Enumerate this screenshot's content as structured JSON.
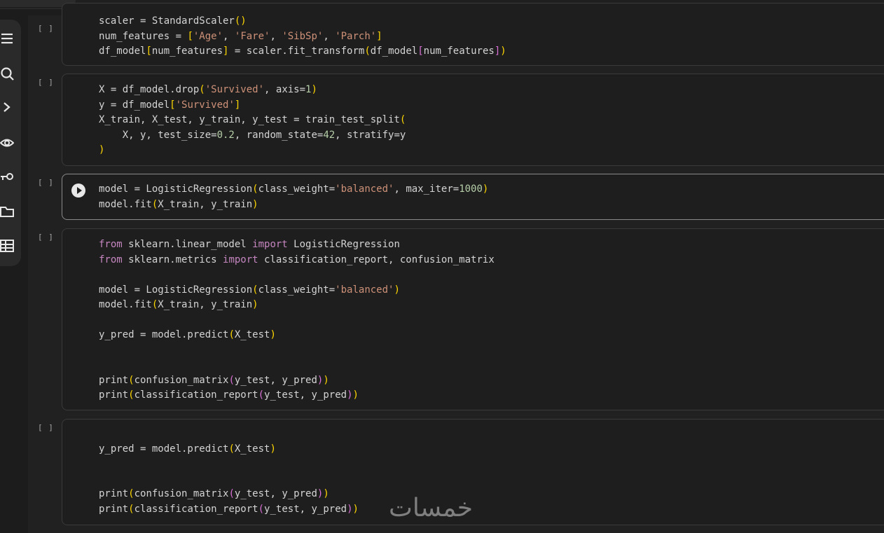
{
  "cells": [
    {
      "exec": "[ ]",
      "lines": [
        [
          {
            "t": "scaler = StandardScaler"
          },
          {
            "t": "()",
            "c": "p1"
          }
        ],
        [
          {
            "t": "num_features = "
          },
          {
            "t": "[",
            "c": "p1"
          },
          {
            "t": "'Age'",
            "c": "st"
          },
          {
            "t": ", "
          },
          {
            "t": "'Fare'",
            "c": "st"
          },
          {
            "t": ", "
          },
          {
            "t": "'SibSp'",
            "c": "st"
          },
          {
            "t": ", "
          },
          {
            "t": "'Parch'",
            "c": "st"
          },
          {
            "t": "]",
            "c": "p1"
          }
        ],
        [
          {
            "t": "df_model"
          },
          {
            "t": "[",
            "c": "p1"
          },
          {
            "t": "num_features"
          },
          {
            "t": "]",
            "c": "p1"
          },
          {
            "t": " = scaler.fit_transform"
          },
          {
            "t": "(",
            "c": "p1"
          },
          {
            "t": "df_model"
          },
          {
            "t": "[",
            "c": "p2"
          },
          {
            "t": "num_features"
          },
          {
            "t": "]",
            "c": "p2"
          },
          {
            "t": ")",
            "c": "p1"
          }
        ]
      ]
    },
    {
      "exec": "[ ]",
      "lines": [
        [
          {
            "t": "X = df_model.drop"
          },
          {
            "t": "(",
            "c": "p1"
          },
          {
            "t": "'Survived'",
            "c": "st"
          },
          {
            "t": ", axis="
          },
          {
            "t": "1",
            "c": "nu"
          },
          {
            "t": ")",
            "c": "p1"
          }
        ],
        [
          {
            "t": "y = df_model"
          },
          {
            "t": "[",
            "c": "p1"
          },
          {
            "t": "'Survived'",
            "c": "st"
          },
          {
            "t": "]",
            "c": "p1"
          }
        ],
        [
          {
            "t": "X_train, X_test, y_train, y_test = train_test_split"
          },
          {
            "t": "(",
            "c": "p1"
          }
        ],
        [
          {
            "t": "    X, y, test_size="
          },
          {
            "t": "0.2",
            "c": "nu"
          },
          {
            "t": ", random_state="
          },
          {
            "t": "42",
            "c": "nu"
          },
          {
            "t": ", stratify=y"
          }
        ],
        [
          {
            "t": ")",
            "c": "p1"
          }
        ]
      ]
    },
    {
      "exec": "[ ]",
      "run_button": "play-icon",
      "lines": [
        [
          {
            "t": "model = LogisticRegression"
          },
          {
            "t": "(",
            "c": "p1"
          },
          {
            "t": "class_weight="
          },
          {
            "t": "'balanced'",
            "c": "st"
          },
          {
            "t": ", max_iter="
          },
          {
            "t": "1000",
            "c": "nu"
          },
          {
            "t": ")",
            "c": "p1"
          }
        ],
        [
          {
            "t": "model.fit"
          },
          {
            "t": "(",
            "c": "p1"
          },
          {
            "t": "X_train, y_train"
          },
          {
            "t": ")",
            "c": "p1"
          }
        ]
      ]
    },
    {
      "exec": "[ ]",
      "lines": [
        [
          {
            "t": "from",
            "c": "kw"
          },
          {
            "t": " sklearn.linear_model "
          },
          {
            "t": "import",
            "c": "kw"
          },
          {
            "t": " LogisticRegression"
          }
        ],
        [
          {
            "t": "from",
            "c": "kw"
          },
          {
            "t": " sklearn.metrics "
          },
          {
            "t": "import",
            "c": "kw"
          },
          {
            "t": " classification_report, confusion_matrix"
          }
        ],
        [],
        [
          {
            "t": "model = LogisticRegression"
          },
          {
            "t": "(",
            "c": "p1"
          },
          {
            "t": "class_weight="
          },
          {
            "t": "'balanced'",
            "c": "st"
          },
          {
            "t": ")",
            "c": "p1"
          }
        ],
        [
          {
            "t": "model.fit"
          },
          {
            "t": "(",
            "c": "p1"
          },
          {
            "t": "X_train, y_train"
          },
          {
            "t": ")",
            "c": "p1"
          }
        ],
        [],
        [
          {
            "t": "y_pred = model.predict"
          },
          {
            "t": "(",
            "c": "p1"
          },
          {
            "t": "X_test"
          },
          {
            "t": ")",
            "c": "p1"
          }
        ],
        [],
        [],
        [
          {
            "t": "print"
          },
          {
            "t": "(",
            "c": "p1"
          },
          {
            "t": "confusion_matrix"
          },
          {
            "t": "(",
            "c": "p2"
          },
          {
            "t": "y_test, y_pred"
          },
          {
            "t": ")",
            "c": "p2"
          },
          {
            "t": ")",
            "c": "p1"
          }
        ],
        [
          {
            "t": "print"
          },
          {
            "t": "(",
            "c": "p1"
          },
          {
            "t": "classification_report"
          },
          {
            "t": "(",
            "c": "p2"
          },
          {
            "t": "y_test, y_pred"
          },
          {
            "t": ")",
            "c": "p2"
          },
          {
            "t": ")",
            "c": "p1"
          }
        ]
      ]
    },
    {
      "exec": "[ ]",
      "lines": [
        [],
        [
          {
            "t": "y_pred = model.predict"
          },
          {
            "t": "(",
            "c": "p1"
          },
          {
            "t": "X_test"
          },
          {
            "t": ")",
            "c": "p1"
          }
        ],
        [],
        [],
        [
          {
            "t": "print"
          },
          {
            "t": "(",
            "c": "p1"
          },
          {
            "t": "confusion_matrix"
          },
          {
            "t": "(",
            "c": "p2"
          },
          {
            "t": "y_test, y_pred"
          },
          {
            "t": ")",
            "c": "p2"
          },
          {
            "t": ")",
            "c": "p1"
          }
        ],
        [
          {
            "t": "print"
          },
          {
            "t": "(",
            "c": "p1"
          },
          {
            "t": "classification_report"
          },
          {
            "t": "(",
            "c": "p2"
          },
          {
            "t": "y_test, y_pred"
          },
          {
            "t": ")",
            "c": "p2"
          },
          {
            "t": ")",
            "c": "p1"
          }
        ]
      ]
    }
  ],
  "sidebar_icons": [
    "menu-icon",
    "search-icon",
    "code-icon",
    "secrets-icon",
    "key-icon",
    "folder-icon",
    "table-icon"
  ],
  "watermark": "خمسات"
}
